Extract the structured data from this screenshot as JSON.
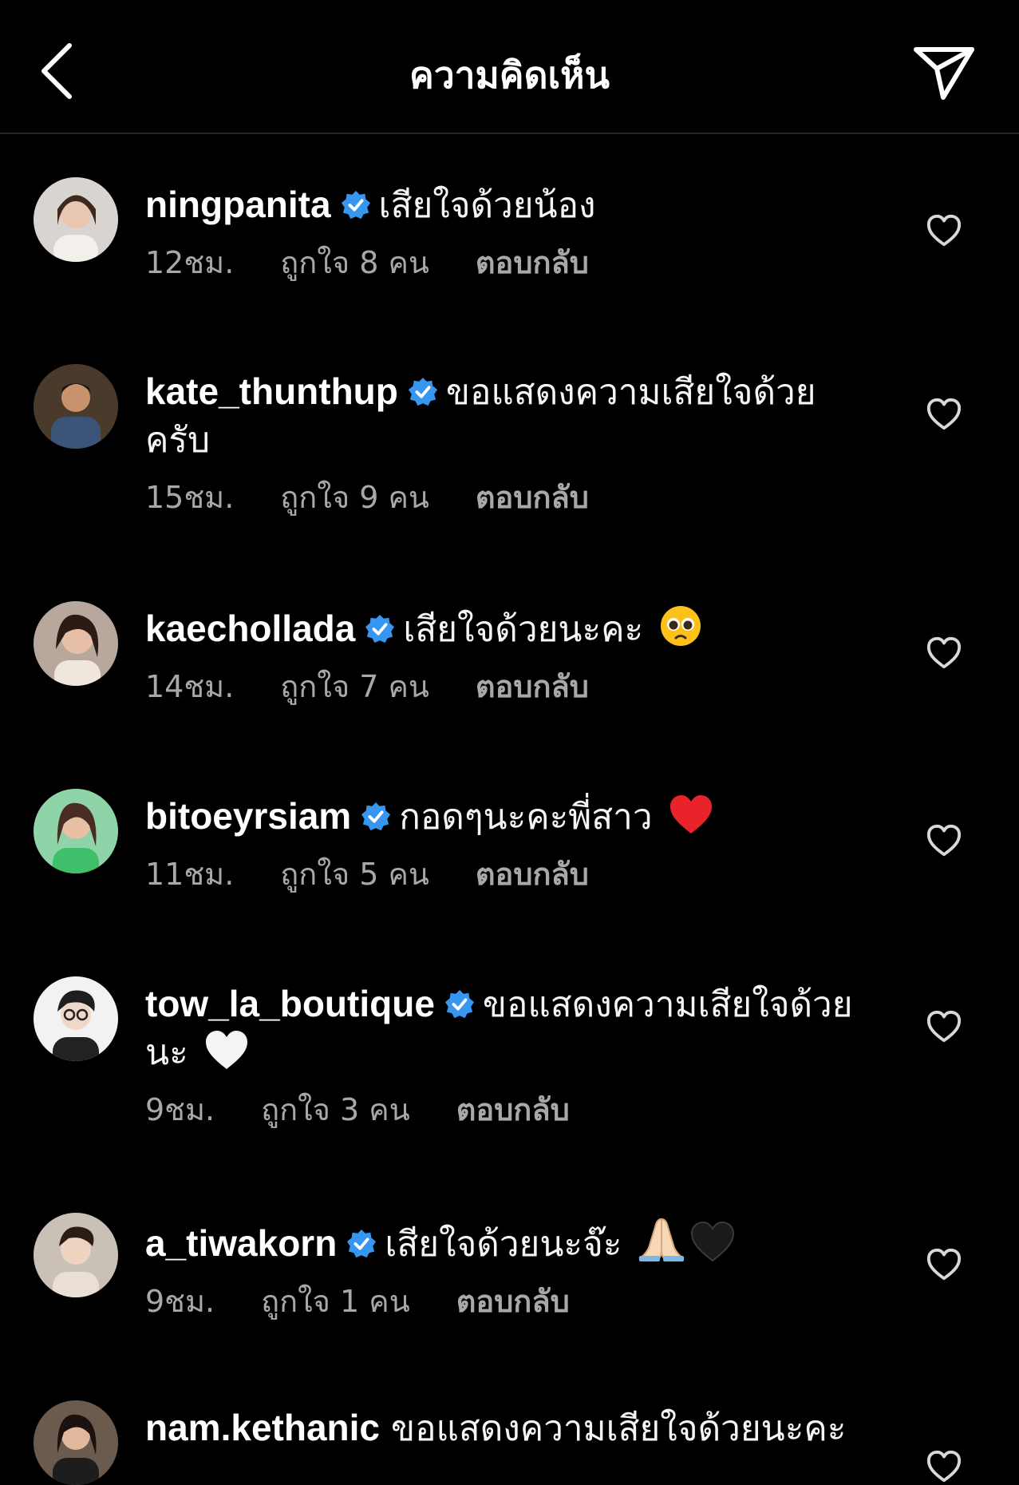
{
  "header": {
    "title": "ความคิดเห็น"
  },
  "comments": [
    {
      "username": "ningpanita",
      "verified": true,
      "text": "เสียใจด้วยน้อง",
      "time": "12ชม.",
      "likes": "ถูกใจ 8 คน",
      "reply": "ตอบกลับ"
    },
    {
      "username": "kate_thunthup",
      "verified": true,
      "text": "ขอแสดงความเสียใจด้วยครับ",
      "time": "15ชม.",
      "likes": "ถูกใจ 9 คน",
      "reply": "ตอบกลับ"
    },
    {
      "username": "kaechollada",
      "verified": true,
      "text": "เสียใจด้วยนะคะ",
      "emoji": "pleading-face",
      "time": "14ชม.",
      "likes": "ถูกใจ 7 คน",
      "reply": "ตอบกลับ"
    },
    {
      "username": "bitoeyrsiam",
      "verified": true,
      "text": "กอดๆนะคะพี่สาว",
      "emoji": "red-heart",
      "time": "11ชม.",
      "likes": "ถูกใจ 5 คน",
      "reply": "ตอบกลับ"
    },
    {
      "username": "tow_la_boutique",
      "verified": true,
      "text": "ขอแสดงความเสียใจด้วยนะ",
      "emoji": "white-heart",
      "time": "9ชม.",
      "likes": "ถูกใจ 3 คน",
      "reply": "ตอบกลับ"
    },
    {
      "username": "a_tiwakorn",
      "verified": true,
      "text": "เสียใจด้วยนะจ๊ะ",
      "emoji": "folded-hands-black-heart",
      "time": "9ชม.",
      "likes": "ถูกใจ 1 คน",
      "reply": "ตอบกลับ"
    },
    {
      "username": "nam.kethanic",
      "verified": false,
      "text": "ขอแสดงความเสียใจด้วยนะคะ"
    }
  ],
  "colors": {
    "background": "#000000",
    "verified": "#3797f0",
    "secondary_text": "#a8a8a8",
    "divider": "#262626"
  }
}
